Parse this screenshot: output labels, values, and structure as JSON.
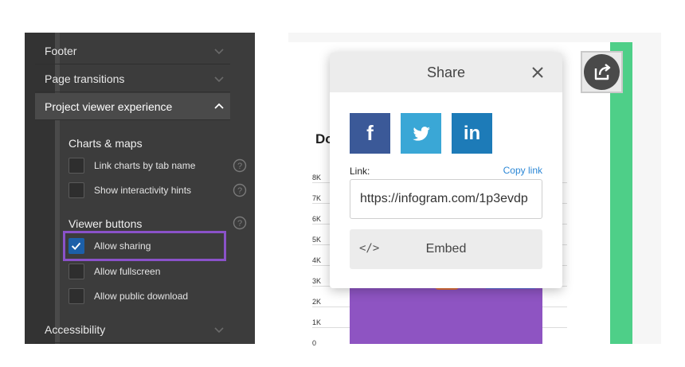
{
  "settings_panel": {
    "accordion": {
      "footer": "Footer",
      "page_transitions": "Page transitions",
      "project_viewer_experience": "Project viewer experience",
      "accessibility": "Accessibility"
    },
    "charts_maps": {
      "heading": "Charts & maps",
      "link_charts": {
        "label": "Link charts by tab name",
        "checked": false
      },
      "interactivity_hints": {
        "label": "Show interactivity hints",
        "checked": false
      }
    },
    "viewer_buttons": {
      "heading": "Viewer buttons",
      "allow_sharing": {
        "label": "Allow sharing",
        "checked": true
      },
      "allow_fullscreen": {
        "label": "Allow fullscreen",
        "checked": false
      },
      "allow_public_download": {
        "label": "Allow public download",
        "checked": false
      }
    },
    "highlight_color": "#8a52c9"
  },
  "chart_preview": {
    "title_fragment": "Do",
    "y_ticks": [
      "8K",
      "7K",
      "6K",
      "5K",
      "4K",
      "3K",
      "2K",
      "1K",
      "0"
    ],
    "bar_color": "#8e54c2",
    "accent_green": "#4ecf88"
  },
  "share_modal": {
    "title": "Share",
    "social": {
      "facebook": "f",
      "linkedin": "in"
    },
    "link_label": "Link:",
    "copy_link": "Copy link",
    "link_value": "https://infogram.com/1p3evdp",
    "embed_code_icon": "</>",
    "embed_label": "Embed"
  },
  "icons": {
    "share": "share-icon",
    "close": "close-icon",
    "help": "help-icon",
    "chevron": "chevron-icon",
    "twitter": "twitter-icon"
  }
}
